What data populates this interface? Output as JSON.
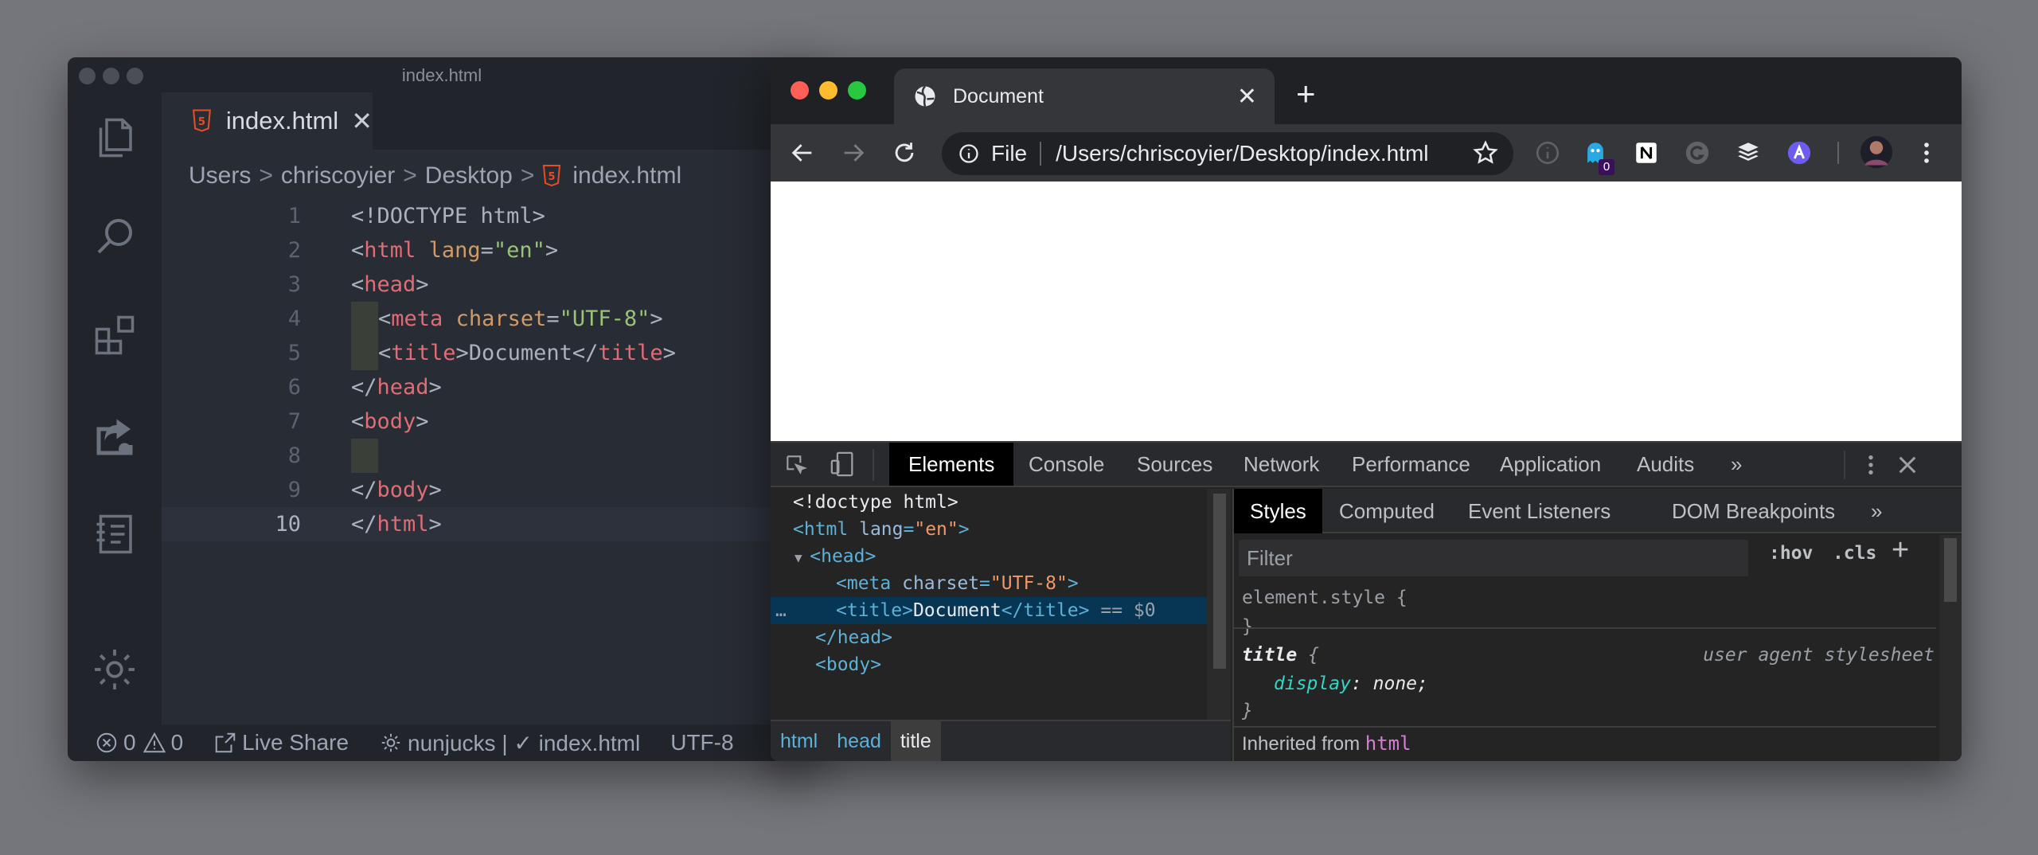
{
  "vscode": {
    "window_title": "index.html",
    "tab": {
      "label": "index.html",
      "close": "✕"
    },
    "breadcrumb": [
      "Users",
      "chriscoyier",
      "Desktop",
      "index.html"
    ],
    "breadcrumb_sep": ">",
    "code_lines": [
      {
        "num": "1"
      },
      {
        "num": "2"
      },
      {
        "num": "3"
      },
      {
        "num": "4"
      },
      {
        "num": "5"
      },
      {
        "num": "6"
      },
      {
        "num": "7"
      },
      {
        "num": "8"
      },
      {
        "num": "9"
      },
      {
        "num": "10"
      }
    ],
    "status": {
      "errors": "0",
      "warnings": "0",
      "live_share": "Live Share",
      "language": "nunjucks | ✓ index.html",
      "encoding": "UTF-8"
    }
  },
  "chrome": {
    "tab": {
      "title": "Document",
      "close": "✕"
    },
    "new_tab": "+",
    "omnibox": {
      "scheme_label": "File",
      "url": "/Users/chriscoyier/Desktop/index.html"
    },
    "extension_badge": "0",
    "devtools": {
      "tabs": [
        "Elements",
        "Console",
        "Sources",
        "Network",
        "Performance",
        "Application",
        "Audits",
        "»"
      ],
      "selected_tab": "Elements",
      "dom_extra": "== $0",
      "breadcrumbs": [
        "html",
        "head",
        "title"
      ],
      "side_tabs": [
        "Styles",
        "Computed",
        "Event Listeners",
        "DOM Breakpoints",
        "»"
      ],
      "filter_placeholder": "Filter",
      "hov": ":hov",
      "cls": ".cls",
      "add": "+",
      "rules": {
        "element_style": "element.style {",
        "close_brace": "}",
        "title_selector": "title",
        "title_open": "{",
        "ua_label": "user agent stylesheet",
        "prop": "display",
        "value": "none;",
        "inherited": "Inherited from",
        "inherited_tag": "html"
      }
    }
  },
  "colors": {
    "accent_selected": "#073655",
    "html5_orange": "#e44d26",
    "traffic_red": "#ff5f57",
    "traffic_yellow": "#febc2e",
    "traffic_green": "#28c840"
  }
}
